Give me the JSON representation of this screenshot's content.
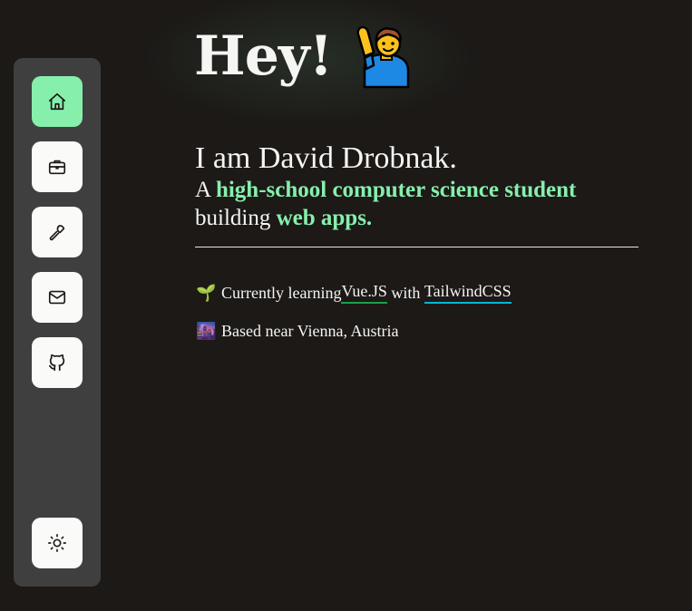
{
  "hero": {
    "title": "Hey!",
    "emoji_icon": "raising-hand-icon"
  },
  "intro": {
    "name_line": "I am David Drobnak.",
    "line2_prefix": "A ",
    "line2_highlight": "high-school computer science student",
    "line3_prefix": "building ",
    "line3_highlight": "web apps."
  },
  "facts": [
    {
      "icon": "seedling-icon",
      "prefix": "Currently learning ",
      "link1": "Vue.JS",
      "middle": " with ",
      "link2": "TailwindCSS"
    },
    {
      "icon": "cityscape-icon",
      "text": "Based near Vienna, Austria"
    }
  ],
  "sidebar": {
    "items": [
      {
        "icon": "home-icon",
        "active": true
      },
      {
        "icon": "briefcase-icon",
        "active": false
      },
      {
        "icon": "wrench-icon",
        "active": false
      },
      {
        "icon": "mail-icon",
        "active": false
      },
      {
        "icon": "github-icon",
        "active": false
      }
    ],
    "theme_toggle_icon": "sun-icon"
  },
  "colors": {
    "background": "#1c1917",
    "sidebar": "#3f3f3f",
    "accent": "#86efac",
    "text": "#f5f5f4",
    "link_vue": "#16a34a",
    "link_tailwind": "#06b6d4"
  }
}
